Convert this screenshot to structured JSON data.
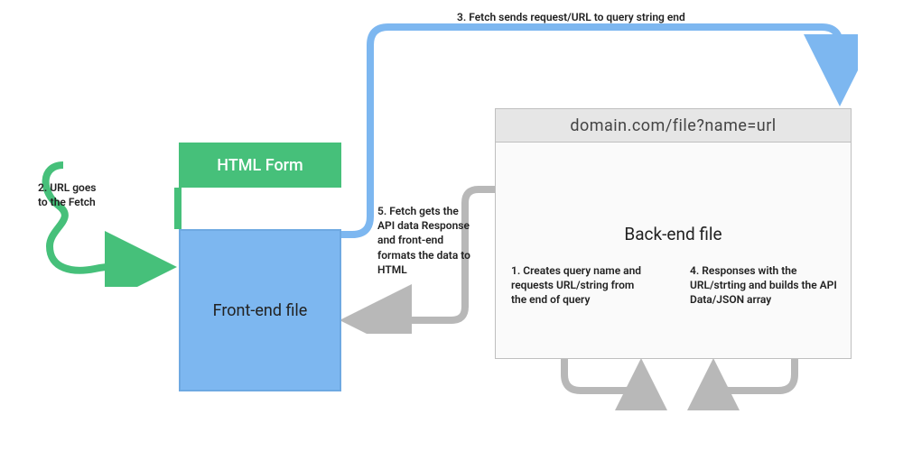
{
  "boxes": {
    "html_form": "HTML Form",
    "frontend": "Front-end file",
    "backend": "Back-end file",
    "domain_bar": "domain.com/file?name=url"
  },
  "labels": {
    "step1": "1.  Creates query name and requests URL/string from the end of query",
    "step2": "2. URL goes to the Fetch",
    "step3": "3. Fetch sends request/URL to query string end",
    "step4": "4. Responses with the URL/strting and builds the API Data/JSON array",
    "step5": "5. Fetch gets the API data Response and front-end formats the data to HTML"
  },
  "colors": {
    "green": "#46c07a",
    "blue": "#7db7f0",
    "lightblue": "#7db7f0",
    "gray": "#b8b8b8"
  }
}
